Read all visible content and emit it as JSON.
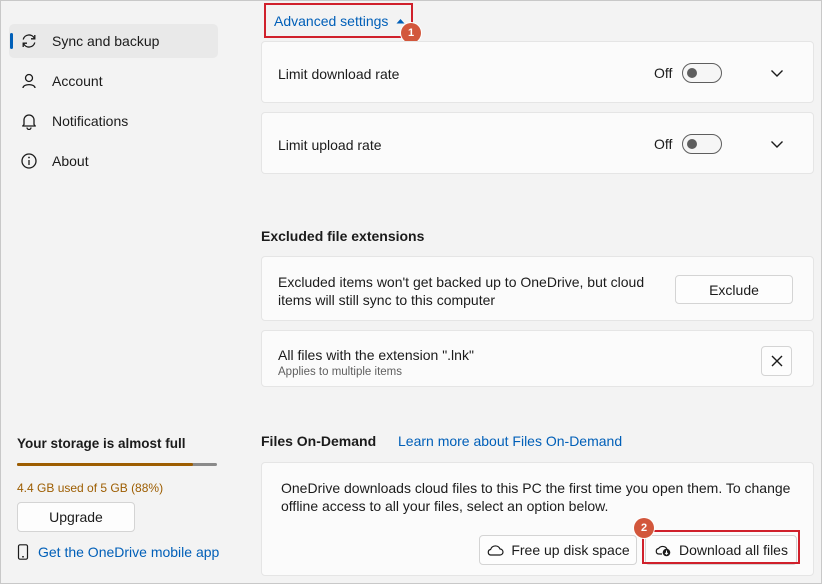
{
  "sidebar": {
    "items": [
      {
        "label": "Sync and backup",
        "icon": "sync-icon",
        "active": true
      },
      {
        "label": "Account",
        "icon": "person-icon"
      },
      {
        "label": "Notifications",
        "icon": "bell-icon"
      },
      {
        "label": "About",
        "icon": "info-icon"
      }
    ],
    "storage": {
      "title": "Your storage is almost full",
      "usage_text": "4.4 GB used of 5 GB (88%)",
      "percent": 88,
      "upgrade_label": "Upgrade",
      "mobile_link": "Get the OneDrive mobile app"
    }
  },
  "advanced": {
    "label": "Advanced settings",
    "marker": "1",
    "rows": [
      {
        "label": "Limit download rate",
        "state": "Off"
      },
      {
        "label": "Limit upload rate",
        "state": "Off"
      }
    ]
  },
  "excluded": {
    "title": "Excluded file extensions",
    "description": "Excluded items won't get backed up to OneDrive, but cloud items will still sync to this computer",
    "exclude_label": "Exclude",
    "item_title": "All files with the extension \".lnk\"",
    "item_subtitle": "Applies to multiple items"
  },
  "on_demand": {
    "title": "Files On-Demand",
    "learn_more": "Learn more about Files On-Demand",
    "description": "OneDrive downloads cloud files to this PC the first time you open them. To change offline access to all your files, select an option below.",
    "free_up_label": "Free up disk space",
    "download_label": "Download all files",
    "marker": "2"
  },
  "colors": {
    "accent": "#005fb8",
    "warning": "#9d5d00",
    "highlight": "#d0202b",
    "marker": "#d2573c"
  }
}
